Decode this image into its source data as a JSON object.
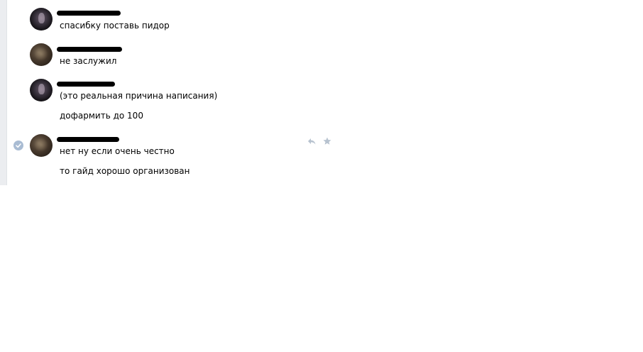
{
  "messages": [
    {
      "author": "",
      "avatar_icon": "user-avatar-dark",
      "lines": [
        "спасибку поставь пидор"
      ]
    },
    {
      "author": "",
      "avatar_icon": "user-avatar-brown",
      "lines": [
        "не заслужил"
      ]
    },
    {
      "author": "",
      "avatar_icon": "user-avatar-dark",
      "lines": [
        "(это реальная причина написания)",
        "дофармить до 100"
      ]
    },
    {
      "author": "",
      "avatar_icon": "user-avatar-brown",
      "lines": [
        "нет ну если очень честно",
        "то гайд хорошо организован"
      ],
      "selected": true
    }
  ],
  "message_actions": {
    "reply_icon": "reply-icon",
    "favorite_icon": "star-icon"
  },
  "colors": {
    "selected_check": "#a9bcd3",
    "action_icon": "#b7c2cf",
    "side_strip": "#ebedf0"
  }
}
